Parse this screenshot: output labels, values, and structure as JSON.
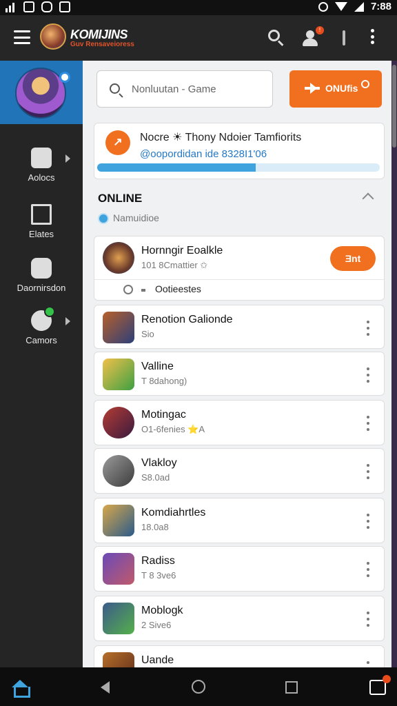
{
  "status_bar": {
    "time": "7:88"
  },
  "app_bar": {
    "title": "KOMIJINS",
    "subtitle": "Guv Rensaveioress"
  },
  "sidebar": {
    "items": [
      {
        "label": "Aolocs",
        "icon": "grid-icon",
        "has_chevron": true
      },
      {
        "label": "Elates",
        "icon": "trophy-icon",
        "has_chevron": false
      },
      {
        "label": "Daornirsdon",
        "icon": "shield-icon",
        "has_chevron": false
      },
      {
        "label": "Camors",
        "icon": "controller-icon",
        "has_chevron": true
      }
    ]
  },
  "search": {
    "placeholder": "Nonluutan - Game"
  },
  "online_button": {
    "label": "ONUfis"
  },
  "notice": {
    "title": "Nocre ☀ Thony Ndoier Tamfiorits",
    "subtitle": "@oopordidan ide 8328I1'06",
    "progress": 0.56
  },
  "section": {
    "header": "ONLINE",
    "status": "Namuidioe"
  },
  "featured_friend": {
    "name": "Hornngir Eoalkle",
    "sub": "101 8Cmattier ✩",
    "button": "Ǝnt",
    "extra": "Ootieestes"
  },
  "friends": [
    {
      "name": "Renotion Galionde",
      "sub": "Sio",
      "avatar_colors": [
        "#b8602a",
        "#2c3f7a"
      ]
    },
    {
      "name": "Valline",
      "sub": "T 8dahong)",
      "avatar_colors": [
        "#f2c04a",
        "#3ca043"
      ]
    },
    {
      "name": "Motingac",
      "sub": "O1-6fenies ⭐A",
      "avatar_colors": [
        "#b43c34",
        "#3a1a3e"
      ]
    },
    {
      "name": "Vlakloy",
      "sub": "S8.0ad",
      "avatar_colors": [
        "#9a9a9a",
        "#3c3c3c"
      ]
    },
    {
      "name": "Komdiahrtles",
      "sub": "18.0a8",
      "avatar_colors": [
        "#d8a84a",
        "#2a5a8a"
      ]
    },
    {
      "name": "Radiss",
      "sub": "T 8 3ve6",
      "avatar_colors": [
        "#6a4ab8",
        "#c05a6a"
      ]
    },
    {
      "name": "Moblogk",
      "sub": "2 Sive6",
      "avatar_colors": [
        "#3c5a8a",
        "#55b04a"
      ]
    },
    {
      "name": "Uande",
      "sub": "",
      "avatar_colors": [
        "#b8702a",
        "#5a2a1a"
      ]
    }
  ]
}
